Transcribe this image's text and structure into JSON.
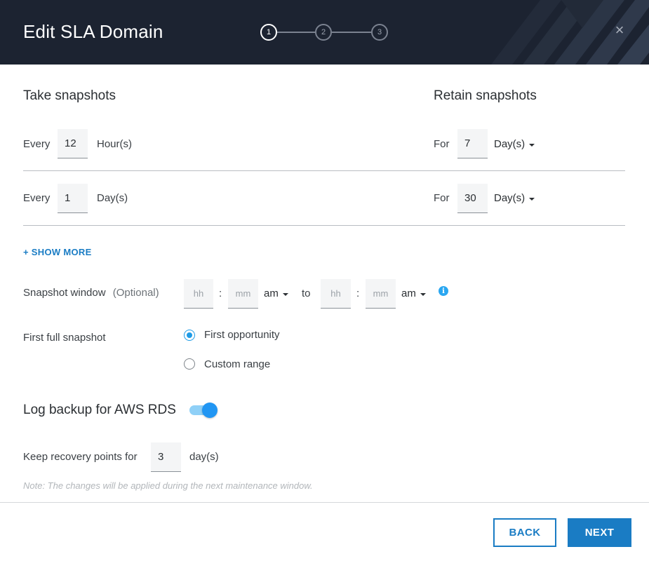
{
  "header": {
    "title": "Edit SLA Domain",
    "steps": [
      "1",
      "2",
      "3"
    ],
    "active_step": 1,
    "close_glyph": "×",
    "background_color": "#1c2331"
  },
  "take": {
    "heading": "Take snapshots",
    "rows": [
      {
        "prefix": "Every",
        "value": "12",
        "unit": "Hour(s)"
      },
      {
        "prefix": "Every",
        "value": "1",
        "unit": "Day(s)"
      }
    ]
  },
  "retain": {
    "heading": "Retain snapshots",
    "rows": [
      {
        "prefix": "For",
        "value": "7",
        "unit": "Day(s)"
      },
      {
        "prefix": "For",
        "value": "30",
        "unit": "Day(s)"
      }
    ]
  },
  "show_more": "+ SHOW MORE",
  "window": {
    "label": "Snapshot window",
    "optional": "(Optional)",
    "start": {
      "hh_placeholder": "hh",
      "mm_placeholder": "mm",
      "ampm": "am"
    },
    "separator": ":",
    "to": "to",
    "end": {
      "hh_placeholder": "hh",
      "mm_placeholder": "mm",
      "ampm": "am"
    },
    "info_glyph": "i"
  },
  "first_full": {
    "label": "First full snapshot",
    "options": [
      {
        "label": "First opportunity",
        "checked": true
      },
      {
        "label": "Custom range",
        "checked": false
      }
    ]
  },
  "log_backup": {
    "heading": "Log backup for AWS RDS",
    "enabled": true,
    "keep_label": "Keep recovery points for",
    "keep_value": "3",
    "keep_unit": "day(s)"
  },
  "note": "Note: The changes will be applied during the next maintenance window.",
  "footer": {
    "back_label": "BACK",
    "next_label": "NEXT"
  },
  "colors": {
    "accent": "#1a7cc4",
    "toggle": "#2196f3",
    "radio": "#1e9be6"
  }
}
